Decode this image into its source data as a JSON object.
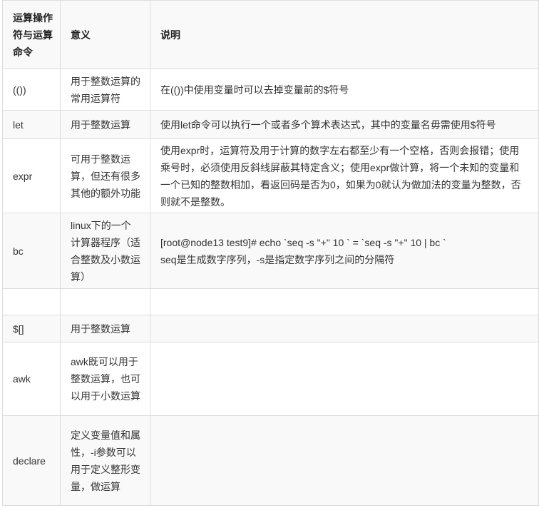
{
  "headers": {
    "operator": "运算操作符与运算命令",
    "meaning": "意义",
    "description": "说明"
  },
  "rows": [
    {
      "operator": "(())",
      "meaning": "用于整数运算的常用运算符",
      "description": "在(())中使用变量时可以去掉变量前的$符号"
    },
    {
      "operator": "let",
      "meaning": "用于整数运算",
      "description": "使用let命令可以执行一个或者多个算术表达式，其中的变量名毋需使用$符号"
    },
    {
      "operator": "expr",
      "meaning": "可用于整数运算，但还有很多其他的额外功能",
      "description": "使用expr时，运算符及用于计算的数字左右都至少有一个空格，否则会报错；使用乘号时，必须使用反斜线屏蔽其特定含义；使用expr做计算，将一个未知的变量和一个已知的整数相加，看返回码是否为0，如果为0就认为做加法的变量为整数，否则就不是整数。"
    },
    {
      "operator": "bc",
      "meaning": "linux下的一个计算器程序（适合整数及小数运算）",
      "description_line1": "[root@node13 test9]# echo `seq -s \"+\" 10 ` = `seq -s \"+\" 10 | bc `",
      "description_line2": "seq是生成数字序列，-s是指定数字序列之间的分隔符"
    },
    {
      "operator": "",
      "meaning": "",
      "description": ""
    },
    {
      "operator": "$[]",
      "meaning": "用于整数运算",
      "description": ""
    },
    {
      "operator": "awk",
      "meaning": "awk既可以用于整数运算，也可以用于小数运算",
      "description": ""
    },
    {
      "operator": "declare",
      "meaning": "定义变量值和属性，-i参数可以用于定义整形变量，做运算",
      "description": ""
    }
  ]
}
